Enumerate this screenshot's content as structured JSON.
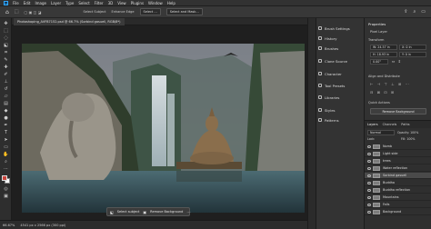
{
  "menubar": {
    "items": [
      "File",
      "Edit",
      "Image",
      "Layer",
      "Type",
      "Select",
      "Filter",
      "3D",
      "View",
      "Plugins",
      "Window",
      "Help"
    ]
  },
  "options": {
    "select_subject": "Select Subject",
    "enhance_edge": "Enhance Edge",
    "select_button": "Select ...",
    "select_and_mask": "Select and Mask..."
  },
  "document": {
    "tab_label": "Photoshoping_AVFB7152.psd @ 66.7% (Sorbind gasuell, RGB/8*)"
  },
  "context_bar": {
    "select_subject": "Select subject",
    "remove_background": "Remove Background"
  },
  "status": {
    "zoom": "66.67%",
    "info": "4541 px x 2566 px (300 ppi)"
  },
  "panel_names": {
    "items": [
      "Brush Settings",
      "History",
      "Brushes",
      "Clone Source",
      "Character",
      "Tool Presets",
      "Libraries",
      "Styles",
      "Patterns"
    ]
  },
  "properties": {
    "title": "Properties",
    "subtitle": "Pixel Layer",
    "transform_label": "Transform",
    "w_value": "W: 24.57 in",
    "h_value": "H: 18.93 in",
    "x_value": "X: 0 in",
    "y_value": "Y: 0 in",
    "angle_value": "0.00°",
    "align_label": "Align and Distribute",
    "quick_actions_label": "Quick Actions",
    "remove_background_button": "Remove Background"
  },
  "layers": {
    "tabs": [
      "Layers",
      "Channels",
      "Paths"
    ],
    "blend_mode": "Normal",
    "opacity": "Opacity: 100%",
    "lock_label": "Lock:",
    "fill": "Fill: 100%",
    "rows": [
      "Nomb",
      "Light side",
      "trees",
      "Water reflection",
      "Sorbind gasuell",
      "Buddha",
      "Buddha reflection",
      "Mountains",
      "Falls",
      "Background"
    ],
    "selected_index": 4
  },
  "colors": {
    "accent": "#31a8ff",
    "foreground": "#c8443c",
    "background": "#ffffff"
  },
  "toolbar_icons": [
    "move-icon",
    "marquee-icon",
    "lasso-icon",
    "object-select-icon",
    "crop-icon",
    "eyedropper-icon",
    "healing-icon",
    "brush-icon",
    "stamp-icon",
    "history-brush-icon",
    "eraser-icon",
    "gradient-icon",
    "blur-icon",
    "dodge-icon",
    "pen-icon",
    "type-icon",
    "path-select-icon",
    "rectangle-icon",
    "hand-icon",
    "zoom-icon"
  ]
}
